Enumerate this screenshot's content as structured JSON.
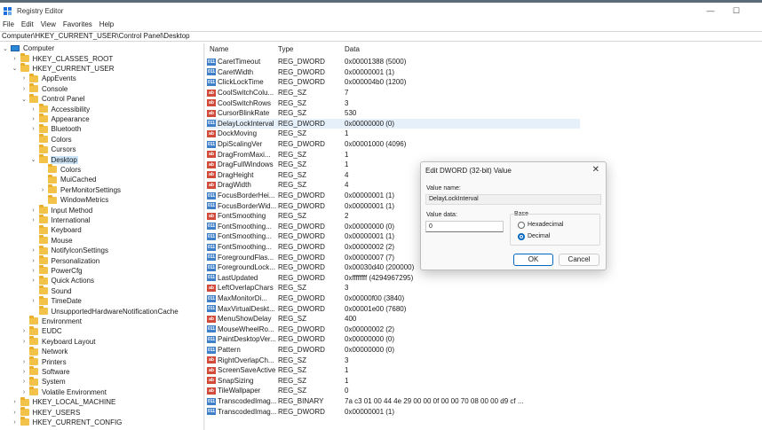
{
  "window": {
    "title": "Registry Editor"
  },
  "menu": [
    "File",
    "Edit",
    "View",
    "Favorites",
    "Help"
  ],
  "address": "Computer\\HKEY_CURRENT_USER\\Control Panel\\Desktop",
  "columns": {
    "name": "Name",
    "type": "Type",
    "data": "Data"
  },
  "tree": [
    {
      "label": "Computer",
      "indent": 0,
      "chev": "v",
      "icon": "pc"
    },
    {
      "label": "HKEY_CLASSES_ROOT",
      "indent": 1,
      "chev": ">"
    },
    {
      "label": "HKEY_CURRENT_USER",
      "indent": 1,
      "chev": "v"
    },
    {
      "label": "AppEvents",
      "indent": 2,
      "chev": ">"
    },
    {
      "label": "Console",
      "indent": 2,
      "chev": ">"
    },
    {
      "label": "Control Panel",
      "indent": 2,
      "chev": "v"
    },
    {
      "label": "Accessibility",
      "indent": 3,
      "chev": ">"
    },
    {
      "label": "Appearance",
      "indent": 3,
      "chev": ">"
    },
    {
      "label": "Bluetooth",
      "indent": 3,
      "chev": ">"
    },
    {
      "label": "Colors",
      "indent": 3,
      "chev": ""
    },
    {
      "label": "Cursors",
      "indent": 3,
      "chev": ""
    },
    {
      "label": "Desktop",
      "indent": 3,
      "chev": "v",
      "selected": true
    },
    {
      "label": "Colors",
      "indent": 4,
      "chev": ""
    },
    {
      "label": "MuiCached",
      "indent": 4,
      "chev": ""
    },
    {
      "label": "PerMonitorSettings",
      "indent": 4,
      "chev": ">"
    },
    {
      "label": "WindowMetrics",
      "indent": 4,
      "chev": ""
    },
    {
      "label": "Input Method",
      "indent": 3,
      "chev": ">"
    },
    {
      "label": "International",
      "indent": 3,
      "chev": ">"
    },
    {
      "label": "Keyboard",
      "indent": 3,
      "chev": ""
    },
    {
      "label": "Mouse",
      "indent": 3,
      "chev": ""
    },
    {
      "label": "NotifyIconSettings",
      "indent": 3,
      "chev": ">"
    },
    {
      "label": "Personalization",
      "indent": 3,
      "chev": ">"
    },
    {
      "label": "PowerCfg",
      "indent": 3,
      "chev": ">"
    },
    {
      "label": "Quick Actions",
      "indent": 3,
      "chev": ">"
    },
    {
      "label": "Sound",
      "indent": 3,
      "chev": ""
    },
    {
      "label": "TimeDate",
      "indent": 3,
      "chev": ">"
    },
    {
      "label": "UnsupportedHardwareNotificationCache",
      "indent": 3,
      "chev": ""
    },
    {
      "label": "Environment",
      "indent": 2,
      "chev": ""
    },
    {
      "label": "EUDC",
      "indent": 2,
      "chev": ">"
    },
    {
      "label": "Keyboard Layout",
      "indent": 2,
      "chev": ">"
    },
    {
      "label": "Network",
      "indent": 2,
      "chev": ""
    },
    {
      "label": "Printers",
      "indent": 2,
      "chev": ">"
    },
    {
      "label": "Software",
      "indent": 2,
      "chev": ">"
    },
    {
      "label": "System",
      "indent": 2,
      "chev": ">"
    },
    {
      "label": "Volatile Environment",
      "indent": 2,
      "chev": ">"
    },
    {
      "label": "HKEY_LOCAL_MACHINE",
      "indent": 1,
      "chev": ">"
    },
    {
      "label": "HKEY_USERS",
      "indent": 1,
      "chev": ">"
    },
    {
      "label": "HKEY_CURRENT_CONFIG",
      "indent": 1,
      "chev": ">"
    }
  ],
  "values": [
    {
      "name": "CaretTimeout",
      "type": "REG_DWORD",
      "data": "0x00001388 (5000)"
    },
    {
      "name": "CaretWidth",
      "type": "REG_DWORD",
      "data": "0x00000001 (1)"
    },
    {
      "name": "ClickLockTime",
      "type": "REG_DWORD",
      "data": "0x000004b0 (1200)"
    },
    {
      "name": "CoolSwitchColu...",
      "type": "REG_SZ",
      "data": "7"
    },
    {
      "name": "CoolSwitchRows",
      "type": "REG_SZ",
      "data": "3"
    },
    {
      "name": "CursorBlinkRate",
      "type": "REG_SZ",
      "data": "530"
    },
    {
      "name": "DelayLockInterval",
      "type": "REG_DWORD",
      "data": "0x00000000 (0)",
      "selected": true
    },
    {
      "name": "DockMoving",
      "type": "REG_SZ",
      "data": "1"
    },
    {
      "name": "DpiScalingVer",
      "type": "REG_DWORD",
      "data": "0x00001000 (4096)"
    },
    {
      "name": "DragFromMaxi...",
      "type": "REG_SZ",
      "data": "1"
    },
    {
      "name": "DragFullWindows",
      "type": "REG_SZ",
      "data": "1"
    },
    {
      "name": "DragHeight",
      "type": "REG_SZ",
      "data": "4"
    },
    {
      "name": "DragWidth",
      "type": "REG_SZ",
      "data": "4"
    },
    {
      "name": "FocusBorderHei...",
      "type": "REG_DWORD",
      "data": "0x00000001 (1)"
    },
    {
      "name": "FocusBorderWid...",
      "type": "REG_DWORD",
      "data": "0x00000001 (1)"
    },
    {
      "name": "FontSmoothing",
      "type": "REG_SZ",
      "data": "2"
    },
    {
      "name": "FontSmoothing...",
      "type": "REG_DWORD",
      "data": "0x00000000 (0)"
    },
    {
      "name": "FontSmoothing...",
      "type": "REG_DWORD",
      "data": "0x00000001 (1)"
    },
    {
      "name": "FontSmoothing...",
      "type": "REG_DWORD",
      "data": "0x00000002 (2)"
    },
    {
      "name": "ForegroundFlas...",
      "type": "REG_DWORD",
      "data": "0x00000007 (7)"
    },
    {
      "name": "ForegroundLock...",
      "type": "REG_DWORD",
      "data": "0x00030d40 (200000)"
    },
    {
      "name": "LastUpdated",
      "type": "REG_DWORD",
      "data": "0xffffffff (4294967295)"
    },
    {
      "name": "LeftOverlapChars",
      "type": "REG_SZ",
      "data": "3"
    },
    {
      "name": "MaxMonitorDi...",
      "type": "REG_DWORD",
      "data": "0x00000f00 (3840)"
    },
    {
      "name": "MaxVirtualDeskt...",
      "type": "REG_DWORD",
      "data": "0x00001e00 (7680)"
    },
    {
      "name": "MenuShowDelay",
      "type": "REG_SZ",
      "data": "400"
    },
    {
      "name": "MouseWheelRo...",
      "type": "REG_DWORD",
      "data": "0x00000002 (2)"
    },
    {
      "name": "PaintDesktopVer...",
      "type": "REG_DWORD",
      "data": "0x00000000 (0)"
    },
    {
      "name": "Pattern",
      "type": "REG_DWORD",
      "data": "0x00000000 (0)"
    },
    {
      "name": "RightOverlapCh...",
      "type": "REG_SZ",
      "data": "3"
    },
    {
      "name": "ScreenSaveActive",
      "type": "REG_SZ",
      "data": "1"
    },
    {
      "name": "SnapSizing",
      "type": "REG_SZ",
      "data": "1"
    },
    {
      "name": "TileWallpaper",
      "type": "REG_SZ",
      "data": "0"
    },
    {
      "name": "TranscodedImag...",
      "type": "REG_BINARY",
      "data": "7a c3 01 00 44 4e 29 00 00 0f 00 00 70 08 00 00 d9 cf ..."
    },
    {
      "name": "TranscodedImag...",
      "type": "REG_DWORD",
      "data": "0x00000001 (1)"
    }
  ],
  "dialog": {
    "title": "Edit DWORD (32-bit) Value",
    "close": "✕",
    "value_name_label": "Value name:",
    "value_name": "DelayLockInterval",
    "value_data_label": "Value data:",
    "value_data": "0",
    "base_label": "Base",
    "hex_label": "Hexadecimal",
    "dec_label": "Decimal",
    "base_selected": "Decimal",
    "ok": "OK",
    "cancel": "Cancel"
  },
  "colors": {
    "selection": "#cce4f7",
    "accent": "#0067c0",
    "folder": "#f3c248"
  }
}
